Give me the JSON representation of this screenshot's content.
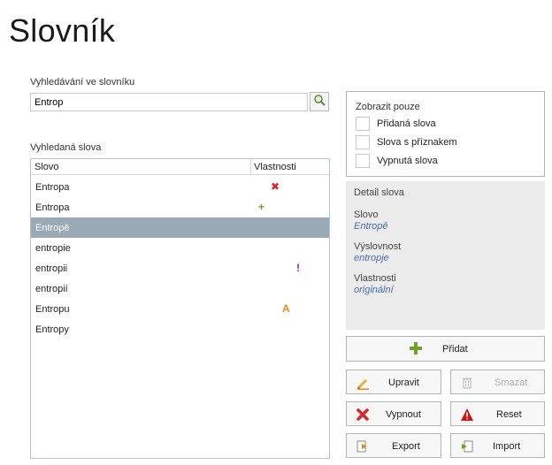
{
  "page": {
    "title": "Slovník"
  },
  "search": {
    "label": "Vyhledávání ve slovníku",
    "value": "Entrop",
    "button_icon": "search-icon"
  },
  "results": {
    "label": "Vyhledaná slova",
    "columns": [
      "Slovo",
      "Vlastnosti"
    ],
    "rows": [
      {
        "word": "Entropa",
        "property": "✖",
        "property_icon": "remove-icon",
        "color": "#d9262a"
      },
      {
        "word": "Entropa",
        "property": "+",
        "property_icon": "add-icon",
        "color": "#6aa32a"
      },
      {
        "word": "Entropě",
        "property": "",
        "property_icon": "",
        "color": ""
      },
      {
        "word": "entropie",
        "property": "",
        "property_icon": "",
        "color": ""
      },
      {
        "word": "entropii",
        "property": "!",
        "property_icon": "flag-icon",
        "color": "#a1259e"
      },
      {
        "word": "entropií",
        "property": "",
        "property_icon": "",
        "color": ""
      },
      {
        "word": "Entropu",
        "property": "A",
        "property_icon": "pronunciation-icon",
        "color": "#f08c1e"
      },
      {
        "word": "Entropy",
        "property": "",
        "property_icon": "",
        "color": ""
      }
    ],
    "selected_index": 2
  },
  "filter": {
    "caption": "Zobrazit pouze",
    "options": [
      {
        "label": "Přidaná slova",
        "checked": false
      },
      {
        "label": "Slova s příznakem",
        "checked": false
      },
      {
        "label": "Vypnutá slova",
        "checked": false
      }
    ]
  },
  "detail": {
    "caption": "Detail slova",
    "word_label": "Slovo",
    "word_value": "Entropě",
    "pron_label": "Výslovnost",
    "pron_value": "entropje",
    "prop_label": "Vlastnosti",
    "prop_value": "originální"
  },
  "actions": {
    "add": "Přidat",
    "edit": "Upravit",
    "delete": "Smazat",
    "disable": "Vypnout",
    "reset": "Reset",
    "export": "Export",
    "import": "Import"
  },
  "colors": {
    "selection": "#9aa9b6",
    "add_green": "#6aa32a",
    "remove_red": "#d9262a",
    "warning_red": "#d0141c",
    "detail_blue": "#4a6db0"
  }
}
